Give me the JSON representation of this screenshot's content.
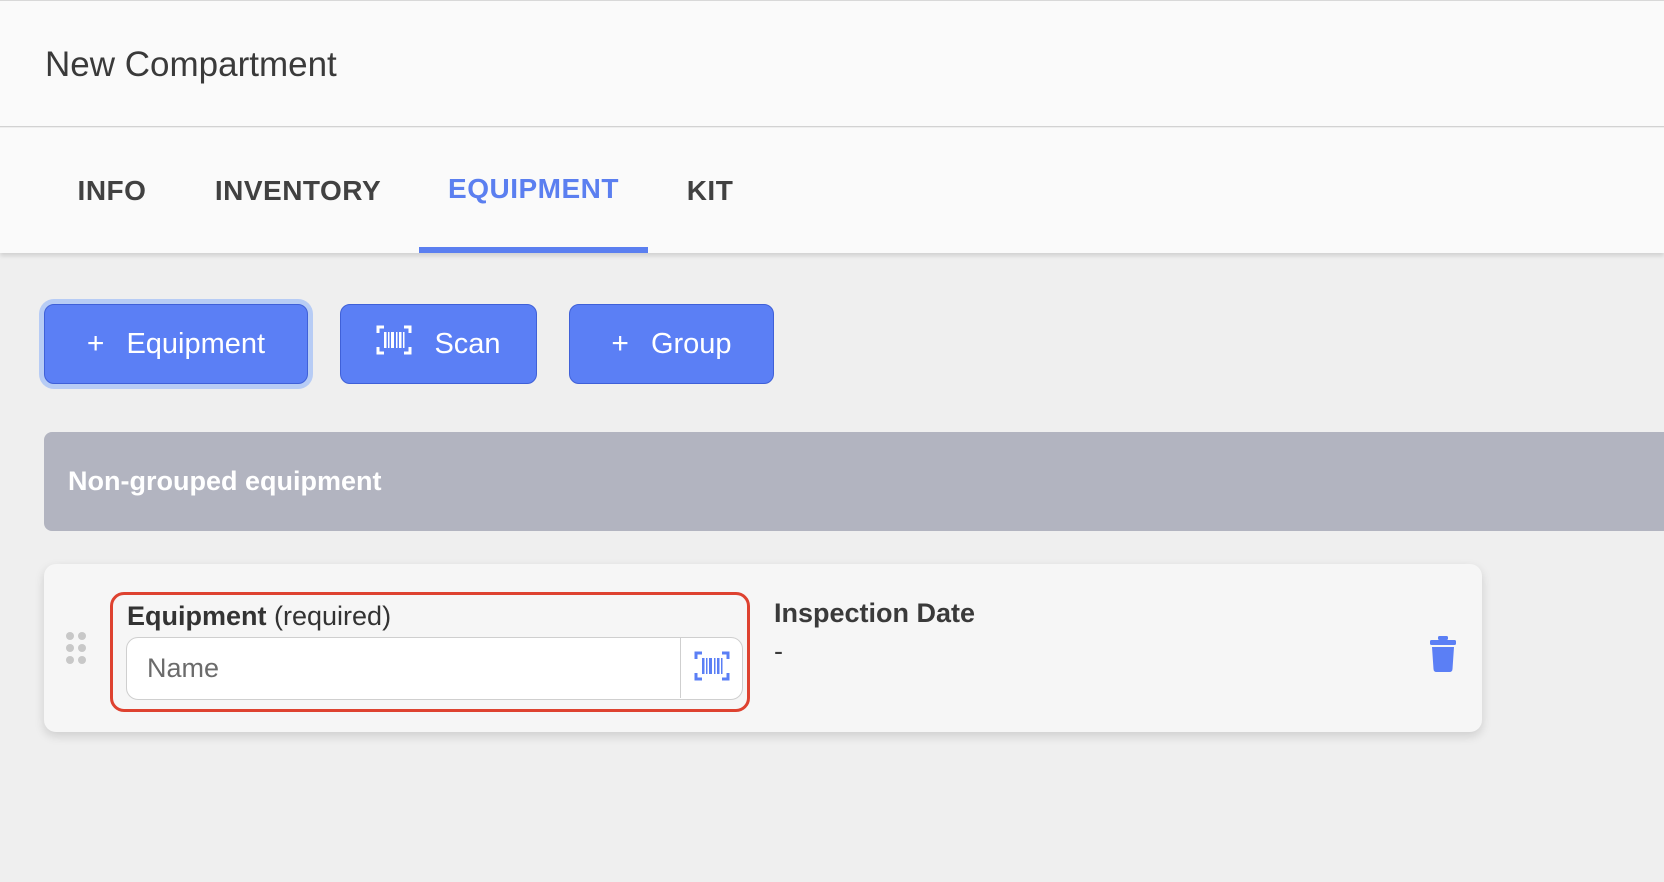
{
  "header": {
    "title": "New Compartment"
  },
  "tabs": [
    {
      "label": "INFO"
    },
    {
      "label": "INVENTORY"
    },
    {
      "label": "EQUIPMENT"
    },
    {
      "label": "KIT"
    }
  ],
  "active_tab": "EQUIPMENT",
  "toolbar": {
    "add_equipment": {
      "icon": "plus-icon",
      "label": "Equipment"
    },
    "scan": {
      "icon": "barcode-icon",
      "label": "Scan"
    },
    "add_group": {
      "icon": "plus-icon",
      "label": "Group"
    }
  },
  "section": {
    "title": "Non-grouped equipment"
  },
  "equipment_item": {
    "field_label_bold": "Equipment",
    "field_label_suffix": "(required)",
    "name_placeholder": "Name",
    "name_value": "",
    "inspection_label": "Inspection Date",
    "inspection_value": "-"
  },
  "colors": {
    "accent": "#5b7ff5",
    "section_header": "#b2b4c0",
    "error_border": "#de4230",
    "background": "#efefef"
  }
}
